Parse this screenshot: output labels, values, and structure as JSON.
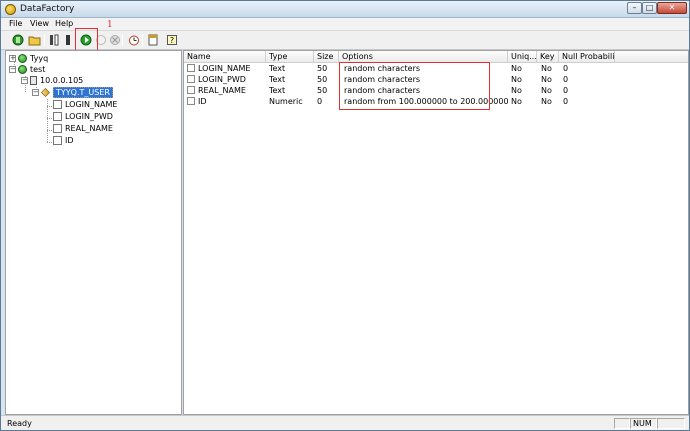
{
  "window": {
    "title": "DataFactory",
    "controls": {
      "minimize": "–",
      "maximize": "□",
      "close": "✕"
    }
  },
  "menu": [
    "File",
    "View",
    "Help"
  ],
  "toolbar": {
    "buttons": [
      {
        "name": "connect-db-icon",
        "glyph": "●"
      },
      {
        "name": "open-folder-icon",
        "glyph": "▭"
      },
      {
        "name": "columns-icon",
        "glyph": "▮"
      },
      {
        "name": "column-icon",
        "glyph": "▯"
      },
      {
        "name": "run-icon",
        "glyph": "▶"
      },
      {
        "name": "pause-icon",
        "glyph": "◌"
      },
      {
        "name": "stop-icon",
        "glyph": "⊘"
      },
      {
        "name": "timer-icon",
        "glyph": "◔"
      },
      {
        "name": "report-icon",
        "glyph": "▤"
      },
      {
        "name": "help-icon",
        "glyph": "?"
      }
    ],
    "annotation": "1"
  },
  "tree": {
    "nodes": [
      {
        "label": "Tyyq"
      },
      {
        "label": "test"
      },
      {
        "label": "10.0.0.105"
      },
      {
        "label": "TYYQ.T_USER"
      },
      {
        "label": "LOGIN_NAME"
      },
      {
        "label": "LOGIN_PWD"
      },
      {
        "label": "REAL_NAME"
      },
      {
        "label": "ID"
      }
    ]
  },
  "grid": {
    "columns": [
      "Name",
      "Type",
      "Size",
      "Options",
      "Uniq...",
      "Key",
      "Null Probabili..."
    ],
    "rows": [
      {
        "name": "LOGIN_NAME",
        "type": "Text",
        "size": "50",
        "options": "random characters",
        "unique": "No",
        "key": "No",
        "null_prob": "0"
      },
      {
        "name": "LOGIN_PWD",
        "type": "Text",
        "size": "50",
        "options": "random characters",
        "unique": "No",
        "key": "No",
        "null_prob": "0"
      },
      {
        "name": "REAL_NAME",
        "type": "Text",
        "size": "50",
        "options": "random characters",
        "unique": "No",
        "key": "No",
        "null_prob": "0"
      },
      {
        "name": "ID",
        "type": "Numeric",
        "size": "0",
        "options": "random from 100.000000 to 200.000000",
        "unique": "No",
        "key": "No",
        "null_prob": "0"
      }
    ]
  },
  "status": {
    "text": "Ready",
    "num": "NUM"
  },
  "colors": {
    "selection": "#3074d2",
    "annotation": "#e03030"
  }
}
